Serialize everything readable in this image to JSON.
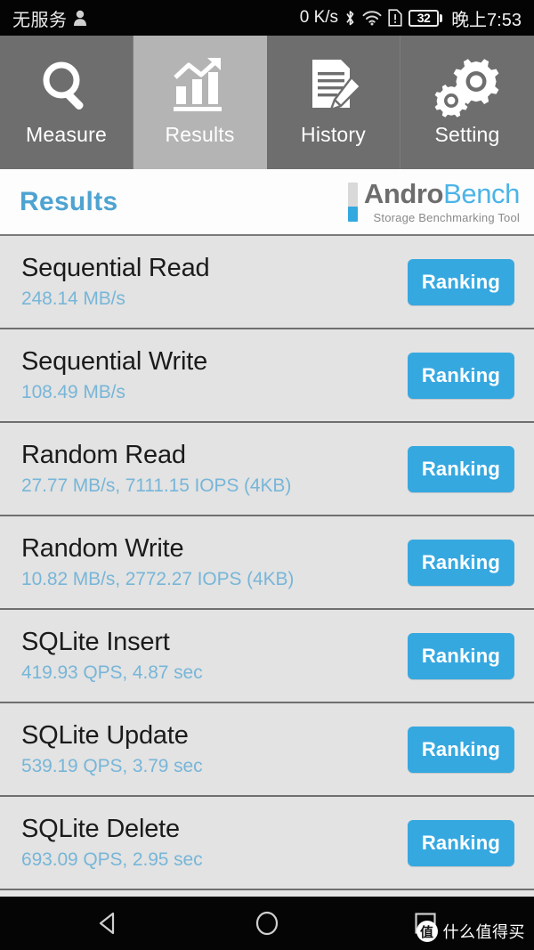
{
  "statusbar": {
    "carrier": "无服务",
    "person_icon": "person-icon",
    "data_rate": "0 K/s",
    "bluetooth_icon": "bluetooth-icon",
    "wifi_icon": "wifi-icon",
    "sim_alert_icon": "sim-alert-icon",
    "battery_level": "32",
    "time": "晚上7:53"
  },
  "tabs": [
    {
      "label": "Measure",
      "icon": "magnifier-icon",
      "selected": false
    },
    {
      "label": "Results",
      "icon": "bar-chart-arrow-icon",
      "selected": true
    },
    {
      "label": "History",
      "icon": "document-pencil-icon",
      "selected": false
    },
    {
      "label": "Setting",
      "icon": "gears-icon",
      "selected": false
    }
  ],
  "header": {
    "title": "Results",
    "logo_primary": "Andro",
    "logo_secondary": "Bench",
    "logo_subtitle": "Storage Benchmarking Tool"
  },
  "results": [
    {
      "name": "Sequential Read",
      "value": "248.14 MB/s",
      "button": "Ranking"
    },
    {
      "name": "Sequential Write",
      "value": "108.49 MB/s",
      "button": "Ranking"
    },
    {
      "name": "Random Read",
      "value": "27.77 MB/s, 7111.15 IOPS (4KB)",
      "button": "Ranking"
    },
    {
      "name": "Random Write",
      "value": "10.82 MB/s, 2772.27 IOPS (4KB)",
      "button": "Ranking"
    },
    {
      "name": "SQLite Insert",
      "value": "419.93 QPS, 4.87 sec",
      "button": "Ranking"
    },
    {
      "name": "SQLite Update",
      "value": "539.19 QPS, 3.79 sec",
      "button": "Ranking"
    },
    {
      "name": "SQLite Delete",
      "value": "693.09 QPS, 2.95 sec",
      "button": "Ranking"
    }
  ],
  "navbar": {
    "back_icon": "back-triangle-icon",
    "home_icon": "home-circle-icon",
    "recents_icon": "recents-square-icon"
  },
  "watermark": {
    "badge": "值",
    "text": "什么值得买"
  },
  "colors": {
    "accent_blue": "#36a8e0",
    "title_blue": "#4ea3d1",
    "value_blue": "#77b6d8",
    "tab_inactive": "#6e6e6e",
    "tab_active": "#b4b4b4",
    "list_bg": "#e3e3e3",
    "logo_gray": "#6d6d6d"
  }
}
